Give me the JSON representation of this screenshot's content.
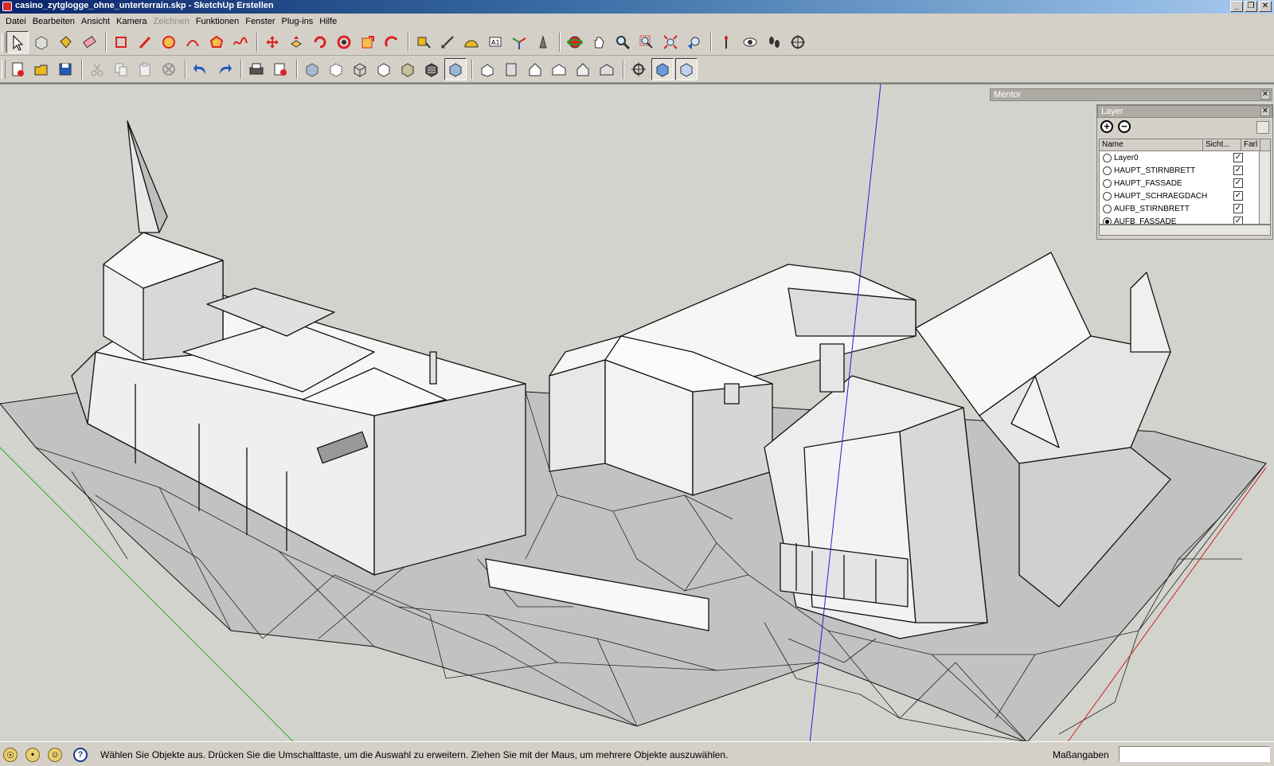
{
  "window": {
    "title": "casino_zytglogge_ohne_unterterrain.skp - SketchUp Erstellen",
    "controls": [
      "minimize-icon",
      "restore-icon",
      "close-icon"
    ]
  },
  "menu": [
    {
      "label": "Datei",
      "enabled": true
    },
    {
      "label": "Bearbeiten",
      "enabled": true
    },
    {
      "label": "Ansicht",
      "enabled": true
    },
    {
      "label": "Kamera",
      "enabled": true
    },
    {
      "label": "Zeichnen",
      "enabled": false
    },
    {
      "label": "Funktionen",
      "enabled": true
    },
    {
      "label": "Fenster",
      "enabled": true
    },
    {
      "label": "Plug-ins",
      "enabled": true
    },
    {
      "label": "Hilfe",
      "enabled": true
    }
  ],
  "toolbar_row1": [
    {
      "icon": "select-arrow-icon",
      "active": true
    },
    {
      "icon": "component-icon"
    },
    {
      "icon": "paint-bucket-icon"
    },
    {
      "icon": "eraser-icon"
    },
    {
      "sep": true
    },
    {
      "icon": "rectangle-icon"
    },
    {
      "icon": "pencil-icon"
    },
    {
      "icon": "circle-icon"
    },
    {
      "icon": "arc-icon"
    },
    {
      "icon": "polygon-icon"
    },
    {
      "icon": "freehand-icon"
    },
    {
      "sep": true
    },
    {
      "icon": "move-icon"
    },
    {
      "icon": "push-pull-icon"
    },
    {
      "icon": "rotate-icon"
    },
    {
      "icon": "follow-me-icon"
    },
    {
      "icon": "scale-icon"
    },
    {
      "icon": "offset-icon"
    },
    {
      "sep": true
    },
    {
      "icon": "tape-measure-icon"
    },
    {
      "icon": "dimension-icon"
    },
    {
      "icon": "protractor-icon"
    },
    {
      "icon": "text-icon"
    },
    {
      "icon": "axes-icon"
    },
    {
      "icon": "3d-text-icon"
    },
    {
      "sep": true
    },
    {
      "icon": "orbit-icon"
    },
    {
      "icon": "pan-hand-icon"
    },
    {
      "icon": "zoom-icon"
    },
    {
      "icon": "zoom-window-icon"
    },
    {
      "icon": "zoom-extents-icon"
    },
    {
      "icon": "previous-view-icon"
    },
    {
      "sep": true
    },
    {
      "icon": "position-camera-icon"
    },
    {
      "icon": "look-around-icon"
    },
    {
      "icon": "walk-icon"
    },
    {
      "icon": "section-plane-icon"
    }
  ],
  "toolbar_row2": [
    {
      "icon": "new-file-icon"
    },
    {
      "icon": "open-folder-icon"
    },
    {
      "icon": "save-icon"
    },
    {
      "sep": true
    },
    {
      "icon": "cut-icon"
    },
    {
      "icon": "copy-icon"
    },
    {
      "icon": "paste-icon"
    },
    {
      "icon": "delete-icon"
    },
    {
      "sep": true
    },
    {
      "icon": "undo-icon"
    },
    {
      "icon": "redo-icon"
    },
    {
      "sep": true
    },
    {
      "icon": "print-icon"
    },
    {
      "icon": "model-info-icon"
    },
    {
      "sep": true
    },
    {
      "icon": "xray-icon"
    },
    {
      "icon": "back-edges-icon"
    },
    {
      "icon": "wireframe-icon"
    },
    {
      "icon": "hidden-line-icon"
    },
    {
      "icon": "shaded-icon"
    },
    {
      "icon": "shaded-textures-icon"
    },
    {
      "icon": "monochrome-icon",
      "active": true
    },
    {
      "sep": true
    },
    {
      "icon": "iso-view-icon"
    },
    {
      "icon": "top-view-icon"
    },
    {
      "icon": "front-view-icon"
    },
    {
      "icon": "right-view-icon"
    },
    {
      "icon": "back-view-icon"
    },
    {
      "icon": "left-view-icon"
    },
    {
      "sep": true
    },
    {
      "icon": "section-toggle-icon"
    },
    {
      "icon": "section-cuts-icon",
      "active": true
    },
    {
      "icon": "section-fill-icon",
      "active": true
    }
  ],
  "mentor": {
    "title": "Mentor"
  },
  "layer_panel": {
    "title": "Layer",
    "add_icon": "add-layer-icon",
    "remove_icon": "remove-layer-icon",
    "columns": [
      "Name",
      "Sicht...",
      "Farl"
    ],
    "layers": [
      {
        "name": "Layer0",
        "active": false,
        "visible": true
      },
      {
        "name": "HAUPT_STIRNBRETT",
        "active": false,
        "visible": true
      },
      {
        "name": "HAUPT_FASSADE",
        "active": false,
        "visible": true
      },
      {
        "name": "HAUPT_SCHRAEGDACH",
        "active": false,
        "visible": true
      },
      {
        "name": "AUFB_STIRNBRETT",
        "active": false,
        "visible": true
      },
      {
        "name": "AUFB_FASSADE",
        "active": true,
        "visible": true
      }
    ]
  },
  "status": {
    "icons": [
      "geo-location-icon",
      "credits-icon",
      "user-icon",
      "help-icon"
    ],
    "message": "Wählen Sie Objekte aus. Drücken Sie die Umschalttaste, um die Auswahl zu erweitern. Ziehen Sie mit der Maus, um mehrere Objekte auszuwählen.",
    "measure_label": "Maßangaben",
    "measure_value": ""
  },
  "colors": {
    "viewport_bg": "#d3d3ce",
    "face": "#f4f4f4",
    "shade": "#cfcfcf",
    "terrain": "#bdbdbd",
    "axis_red": "#cc2222",
    "axis_green": "#22aa22",
    "axis_blue": "#2222cc"
  }
}
